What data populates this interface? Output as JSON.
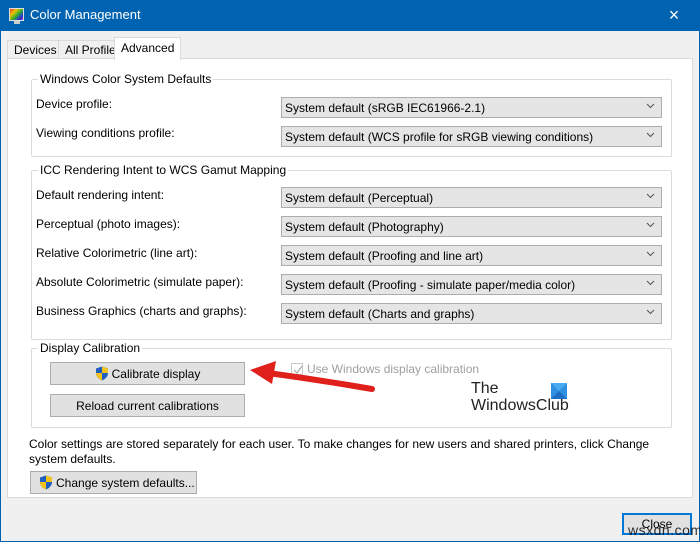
{
  "window": {
    "title": "Color Management",
    "close_icon": "×"
  },
  "tabs": [
    {
      "label": "Devices",
      "active": false
    },
    {
      "label": "All Profiles",
      "active": false
    },
    {
      "label": "Advanced",
      "active": true
    }
  ],
  "wcs_defaults": {
    "legend": "Windows Color System Defaults",
    "rows": [
      {
        "label": "Device profile:",
        "value": "System default (sRGB IEC61966-2.1)"
      },
      {
        "label": "Viewing conditions profile:",
        "value": "System default (WCS profile for sRGB viewing conditions)"
      }
    ]
  },
  "icc_mapping": {
    "legend": "ICC Rendering Intent to WCS Gamut Mapping",
    "rows": [
      {
        "label": "Default rendering intent:",
        "value": "System default (Perceptual)"
      },
      {
        "label": "Perceptual (photo images):",
        "value": "System default (Photography)"
      },
      {
        "label": "Relative Colorimetric (line art):",
        "value": "System default (Proofing and line art)"
      },
      {
        "label": "Absolute Colorimetric (simulate paper):",
        "value": "System default (Proofing - simulate paper/media color)"
      },
      {
        "label": "Business Graphics (charts and graphs):",
        "value": "System default (Charts and graphs)"
      }
    ]
  },
  "calibration": {
    "legend": "Display Calibration",
    "calibrate_button": "Calibrate display",
    "reload_button": "Reload current calibrations",
    "use_windows_calibration_label": "Use Windows display calibration",
    "use_windows_calibration_checked": true,
    "use_windows_calibration_enabled": false
  },
  "footer": {
    "info_text": "Color settings are stored separately for each user. To make changes for new users and shared printers, click Change system defaults.",
    "change_defaults_button": "Change system defaults...",
    "close_button": "Close"
  },
  "watermarks": {
    "brand_line1": "The",
    "brand_line2": "WindowsClub",
    "site": "wsxdn.com"
  },
  "colors": {
    "titlebar": "#0063b1",
    "accent_border": "#0078d7",
    "annotation_arrow": "#e0201b"
  }
}
